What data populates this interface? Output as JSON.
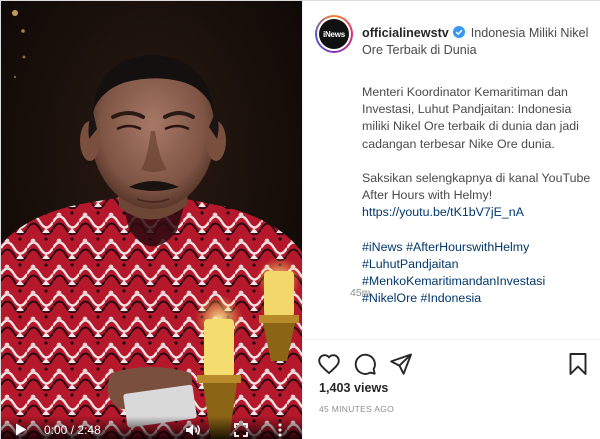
{
  "video": {
    "current_time": "0:00",
    "separator": "/",
    "duration": "2:48",
    "play_state": "paused",
    "progress_fraction": 0
  },
  "post": {
    "avatar_text": "iNews",
    "username": "officialinewstv",
    "verified": true,
    "title": "Indonesia Miliki Nikel Ore Terbaik di Dunia",
    "paragraph1": "Menteri Koordinator Kemaritiman dan Investasi, Luhut Pandjaitan: Indonesia miliki Nikel Ore terbaik di dunia dan jadi cadangan terbesar Nike Ore dunia.",
    "paragraph2": "Saksikan selengkapnya di kanal YouTube After Hours with Helmy!",
    "link": "https://youtu.be/tK1bV7jE_nA",
    "hashtags": [
      "#iNews #AfterHourswithHelmy",
      "#LuhutPandjaitan",
      "#MenkoKemaritimandanInvestasi",
      "#NikelOre #Indonesia"
    ],
    "relative_time": "45m",
    "views": "1,403 views",
    "posted": "45 MINUTES AGO"
  },
  "icons": {
    "play": "play-icon",
    "volume": "volume-icon",
    "fullscreen": "fullscreen-icon",
    "more": "more-vertical-icon",
    "like": "heart-icon",
    "comment": "comment-icon",
    "share": "paper-plane-icon",
    "save": "bookmark-icon",
    "verified": "verified-badge-icon"
  },
  "colors": {
    "link": "#00376b",
    "verified": "#3897f0",
    "muted": "#8e8e8e"
  }
}
